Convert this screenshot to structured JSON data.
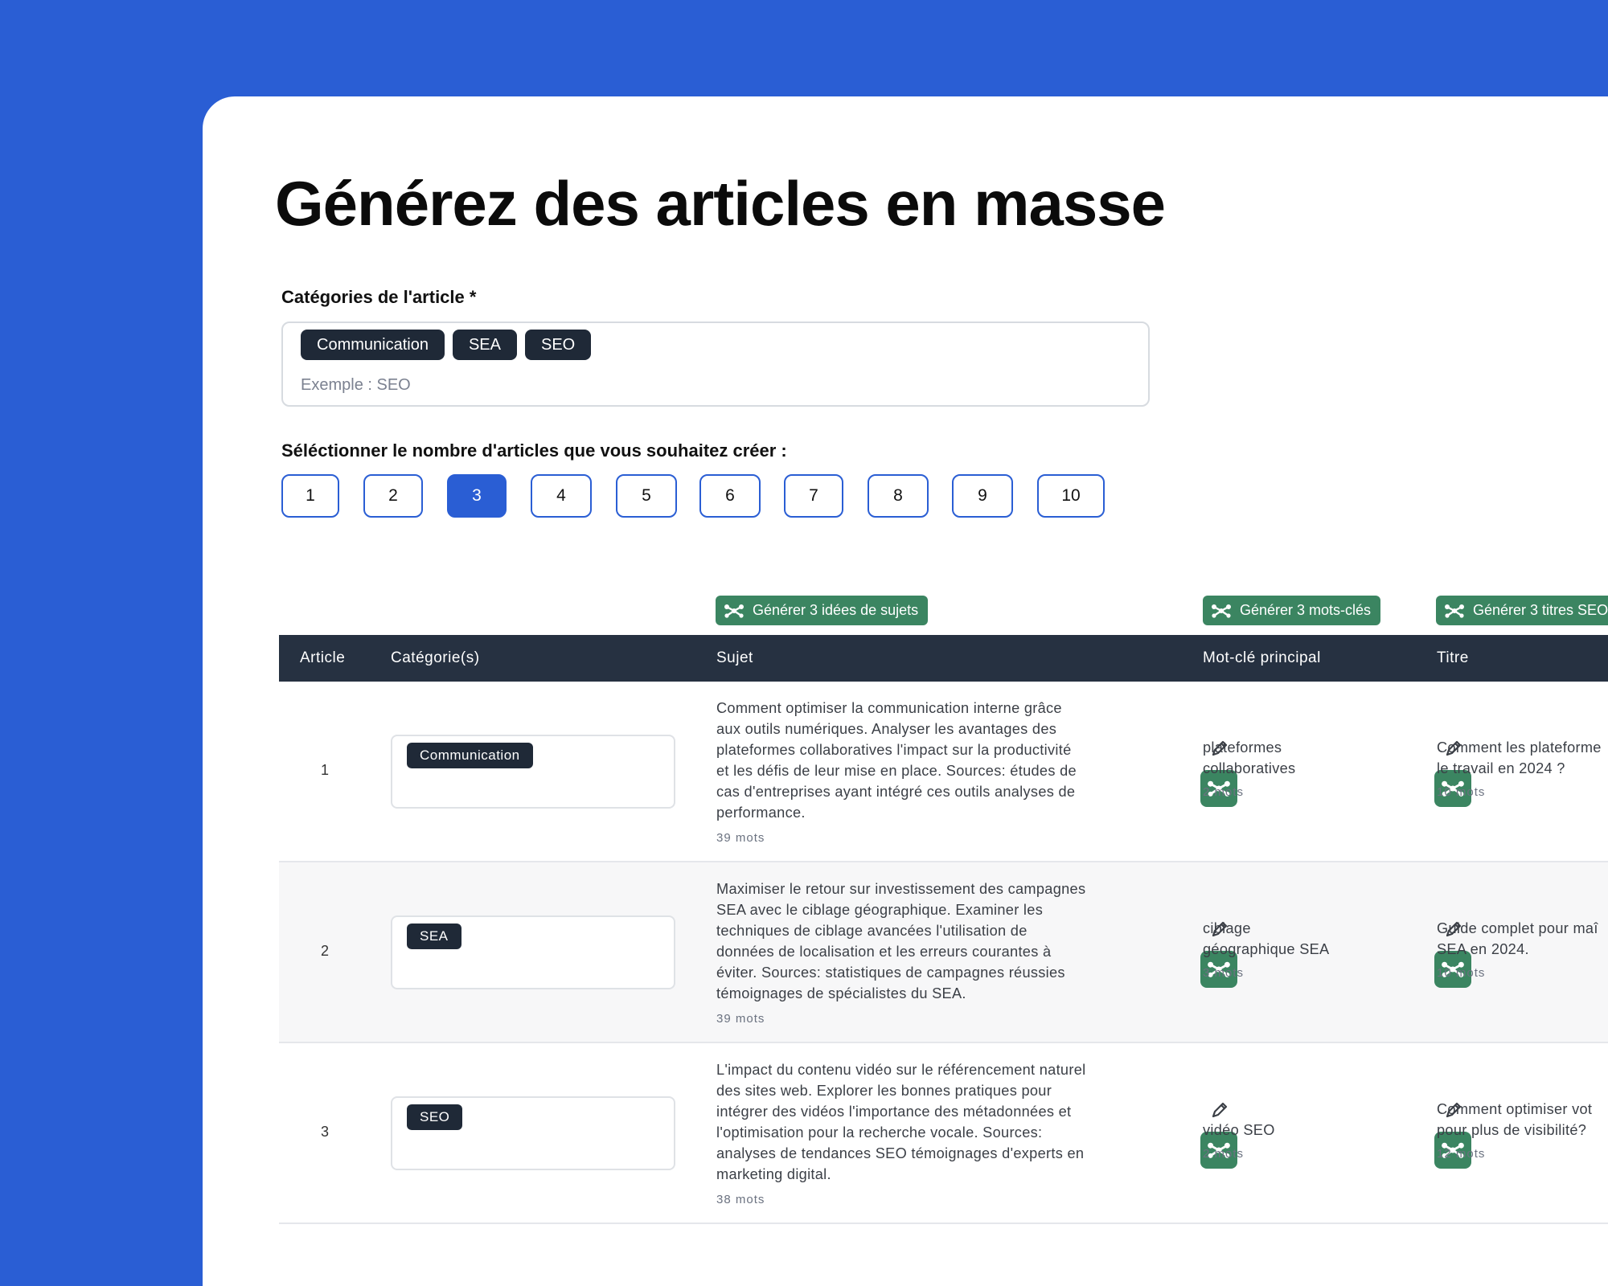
{
  "page": {
    "title": "Générez des articles en masse",
    "categories_label": "Catégories de l'article *",
    "categories": [
      "Communication",
      "SEA",
      "SEO"
    ],
    "categories_placeholder": "Exemple : SEO",
    "count_label": "Séléctionner le nombre d'articles que vous souhaitez créer :",
    "counts": [
      "1",
      "2",
      "3",
      "4",
      "5",
      "6",
      "7",
      "8",
      "9",
      "10"
    ],
    "selected_count": "3"
  },
  "actions": {
    "generate_subjects": "Générer 3 idées de sujets",
    "generate_keywords": "Générer 3 mots-clés",
    "generate_titles": "Générer 3 titres SEO"
  },
  "table": {
    "headers": [
      "Article",
      "Catégorie(s)",
      "Sujet",
      "Mot-clé principal",
      "Titre"
    ],
    "rows": [
      {
        "num": "1",
        "category": "Communication",
        "subject_lines": [
          "Comment optimiser la communication interne grâce",
          "aux outils numériques. Analyser les avantages des",
          "plateformes collaboratives l'impact sur la productivité",
          "et les défis de leur mise en place. Sources: études de",
          "cas d'entreprises ayant intégré ces outils analyses de",
          "performance."
        ],
        "subject_words": "39 mots",
        "keyword_lines": [
          "plateformes",
          "collaboratives"
        ],
        "keyword_words": "2 mots",
        "title_lines": [
          "Comment les plateforme",
          "le travail en 2024 ?"
        ],
        "title_words": "10 mots"
      },
      {
        "num": "2",
        "category": "SEA",
        "subject_lines": [
          "Maximiser le retour sur investissement des campagnes",
          "SEA avec le ciblage géographique. Examiner les",
          "techniques de ciblage avancées l'utilisation de",
          "données de localisation et les erreurs courantes à",
          "éviter. Sources: statistiques de campagnes réussies",
          "témoignages de spécialistes du SEA."
        ],
        "subject_words": "39 mots",
        "keyword_lines": [
          "ciblage",
          "géographique SEA"
        ],
        "keyword_words": "3 mots",
        "title_lines": [
          "Guide complet pour maî",
          "SEA en 2024."
        ],
        "title_words": "10 mots"
      },
      {
        "num": "3",
        "category": "SEO",
        "subject_lines": [
          "L'impact du contenu vidéo sur le référencement naturel",
          "des sites web. Explorer les bonnes pratiques pour",
          "intégrer des vidéos l'importance des métadonnées et",
          "l'optimisation pour la recherche vocale. Sources:",
          "analyses de tendances SEO témoignages d'experts en",
          "marketing digital."
        ],
        "subject_words": "38 mots",
        "keyword_lines": [
          "vidéo SEO"
        ],
        "keyword_words": "2 mots",
        "title_lines": [
          "Comment optimiser vot",
          "pour plus de visibilité?"
        ],
        "title_words": "12 mots"
      }
    ]
  },
  "colors": {
    "background": "#2a5ed4",
    "accent_blue": "#2a5ed4",
    "dark_chip": "#1f2937",
    "table_header": "#263141",
    "ai_green": "#3b8561"
  },
  "icons": {
    "edit": "pencil-icon",
    "ai": "ai-generate-icon"
  }
}
